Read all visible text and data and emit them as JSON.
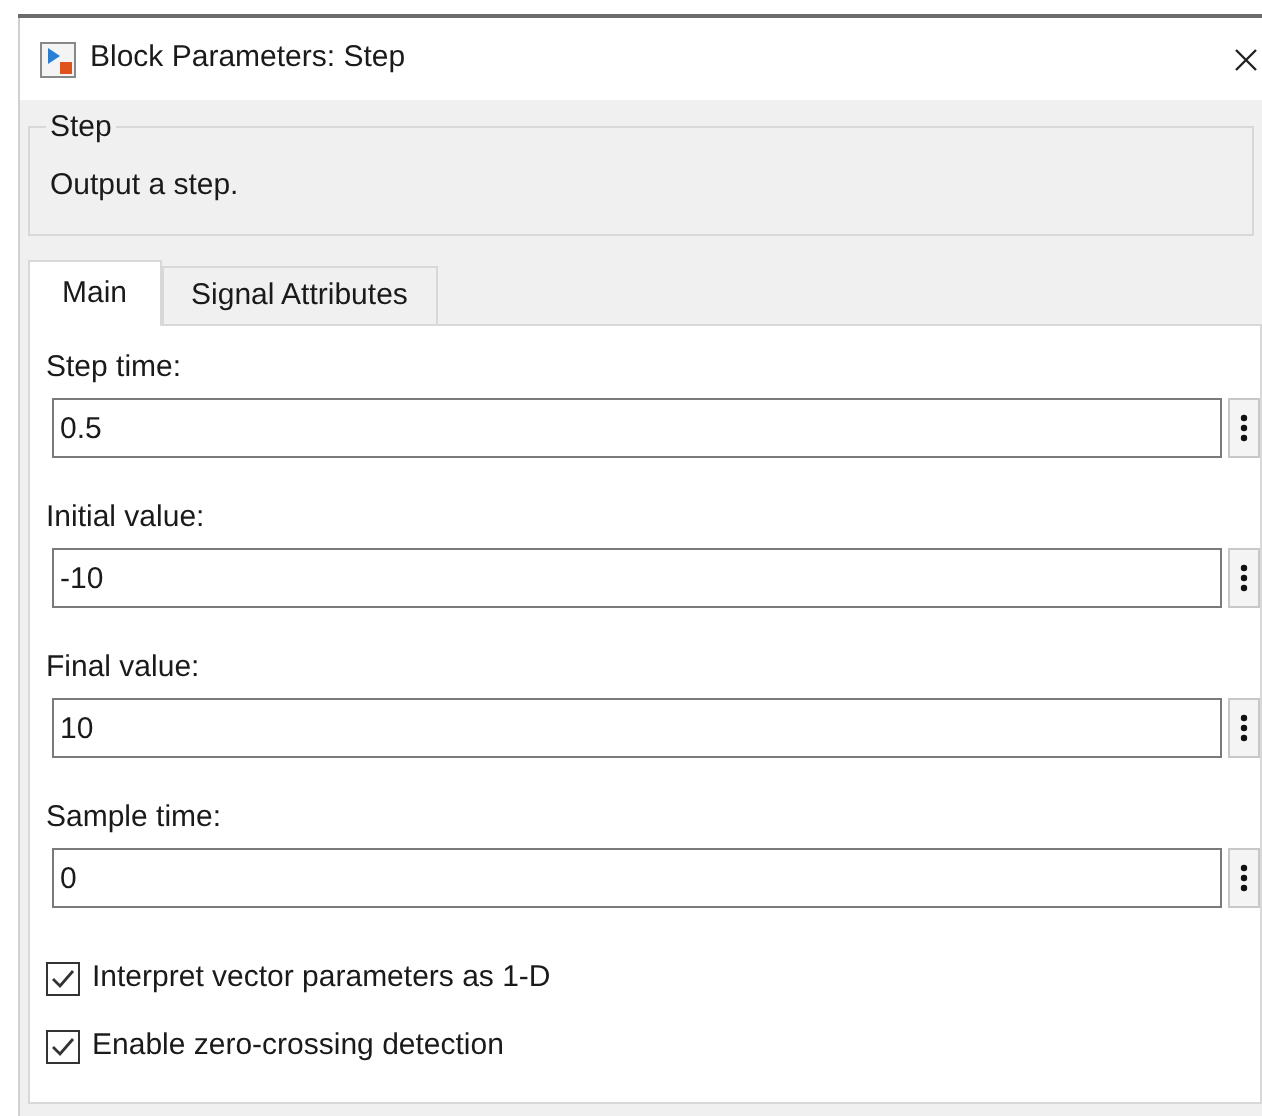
{
  "window": {
    "title": "Block Parameters: Step"
  },
  "group": {
    "title": "Step",
    "description": "Output a step."
  },
  "tabs": [
    {
      "label": "Main",
      "selected": true
    },
    {
      "label": "Signal Attributes",
      "selected": false
    }
  ],
  "parameters": [
    {
      "label": "Step time:",
      "value": "0.5"
    },
    {
      "label": "Initial value:",
      "value": "-10"
    },
    {
      "label": "Final value:",
      "value": "10"
    },
    {
      "label": "Sample time:",
      "value": "0"
    }
  ],
  "options": [
    {
      "label": "Interpret vector parameters as 1-D",
      "checked": true
    },
    {
      "label": "Enable zero-crossing detection",
      "checked": true
    }
  ]
}
